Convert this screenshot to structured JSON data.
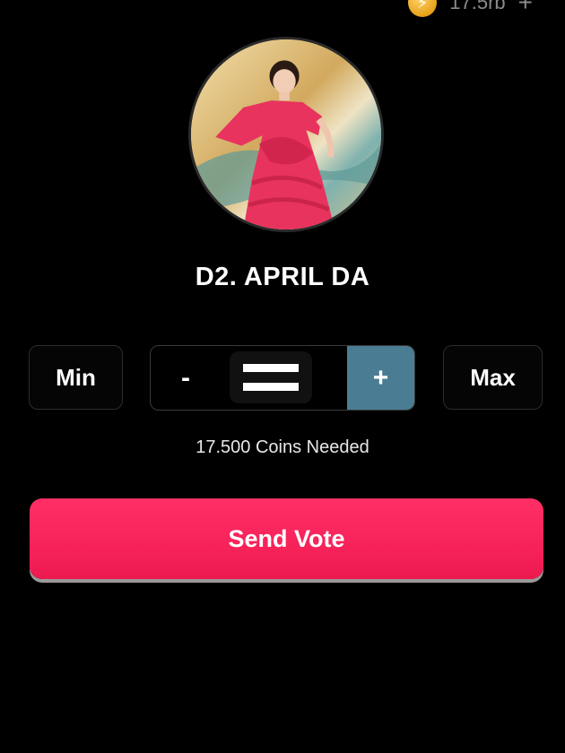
{
  "balance": {
    "icon": "lightning-coin-icon",
    "amount": "17.5rb",
    "add_label": "+"
  },
  "candidate": {
    "name": "D2. APRIL DA",
    "avatar": "candidate-photo"
  },
  "controls": {
    "min_label": "Min",
    "max_label": "Max",
    "decrement_label": "-",
    "increment_label": "+",
    "increment_color": "#4a7d93"
  },
  "coins_needed": "17.500 Coins Needed",
  "send_vote": {
    "label": "Send Vote",
    "color": "#f7225a"
  }
}
